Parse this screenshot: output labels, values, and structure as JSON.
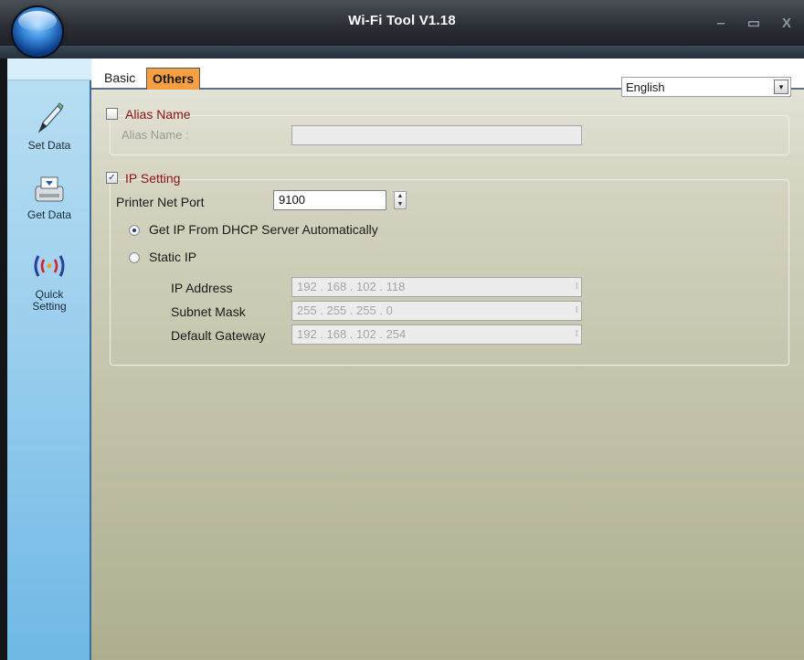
{
  "window": {
    "title": "Wi-Fi Tool V1.18",
    "minimize": "‒",
    "maximize": "▭",
    "close": "X"
  },
  "sidebar": {
    "items": [
      {
        "label": "Set Data",
        "icon": "pen-icon"
      },
      {
        "label": "Get Data",
        "icon": "printer-download-icon"
      },
      {
        "label": "Quick Setting",
        "icon": "wireless-icon"
      }
    ],
    "quick_line1": "Quick",
    "quick_line2": "Setting"
  },
  "tabs": {
    "basic": "Basic",
    "others": "Others",
    "active": "Others"
  },
  "language": {
    "selected": "English",
    "arrow": "▾"
  },
  "alias": {
    "group_title": "Alias Name",
    "checked": false,
    "field_label": "Alias Name :",
    "value": ""
  },
  "ip_setting": {
    "group_title": "IP Setting",
    "checked": true,
    "check_mark": "✓",
    "port_label": "Printer Net Port",
    "port_value": "9100",
    "dhcp_label": "Get IP From DHCP Server Automatically",
    "dhcp_selected": true,
    "static_label": "Static IP",
    "ip_address_label": "IP Address",
    "ip_address_value": "192 . 168 . 102 . 118",
    "subnet_label": "Subnet Mask",
    "subnet_value": "255 . 255 . 255 . 0",
    "gateway_label": "Default Gateway",
    "gateway_value": "192 . 168 . 102 . 254",
    "field_marker": "I"
  },
  "colors": {
    "tab_active": "#f6a043",
    "group_title": "#8b1212",
    "sidebar": "#9fd1ee"
  }
}
